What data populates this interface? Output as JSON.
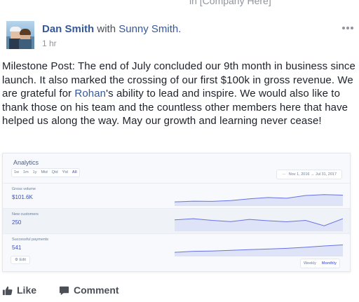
{
  "top_fragment": "in [Company Here]",
  "post": {
    "author": "Dan Smith",
    "with_word": "with",
    "tagged": "Sunny Smith.",
    "timestamp": "1 hr",
    "text": {
      "before_mention": "Milestone Post: The end of July concluded our 9th month in business since launch. It also marked the crossing of our first $100k in gross revenue. We are grateful for ",
      "mention": "Rohan",
      "after_mention": "'s ability to lead and inspire. We would also like to thank those on his team and the countless other members here that have helped us along the way. May our growth and learning never cease!"
    }
  },
  "analytics": {
    "title": "Analytics",
    "range_tabs": [
      "1w",
      "1m",
      "1y",
      "Mtd",
      "Qtd",
      "Ytd",
      "All"
    ],
    "active_tab": "All",
    "date_from": "Nov 1, 2016",
    "date_arrow": "→",
    "date_to": "Jul 31, 2017",
    "metrics": [
      {
        "label": "Gross volume",
        "value": "$101.6K",
        "trend": [
          0.12,
          0.16,
          0.15,
          0.2,
          0.3,
          0.38,
          0.34,
          0.5,
          0.55,
          0.52
        ]
      },
      {
        "label": "New customers",
        "value": "250",
        "trend": [
          0.55,
          0.62,
          0.52,
          0.45,
          0.58,
          0.5,
          0.44,
          0.52,
          0.2,
          0.62
        ]
      },
      {
        "label": "Successful payments",
        "value": "541",
        "trend": [
          0.12,
          0.18,
          0.2,
          0.24,
          0.28,
          0.32,
          0.36,
          0.42,
          0.5,
          0.56
        ]
      }
    ],
    "edit_label": "Edit",
    "view_options": [
      "Weekly",
      "Monthly"
    ],
    "active_view": "Monthly",
    "colors": {
      "line": "#6772e5",
      "fill": "#dfe3f7",
      "value": "#3f51b5"
    }
  },
  "actions": {
    "like": "Like",
    "comment": "Comment"
  }
}
